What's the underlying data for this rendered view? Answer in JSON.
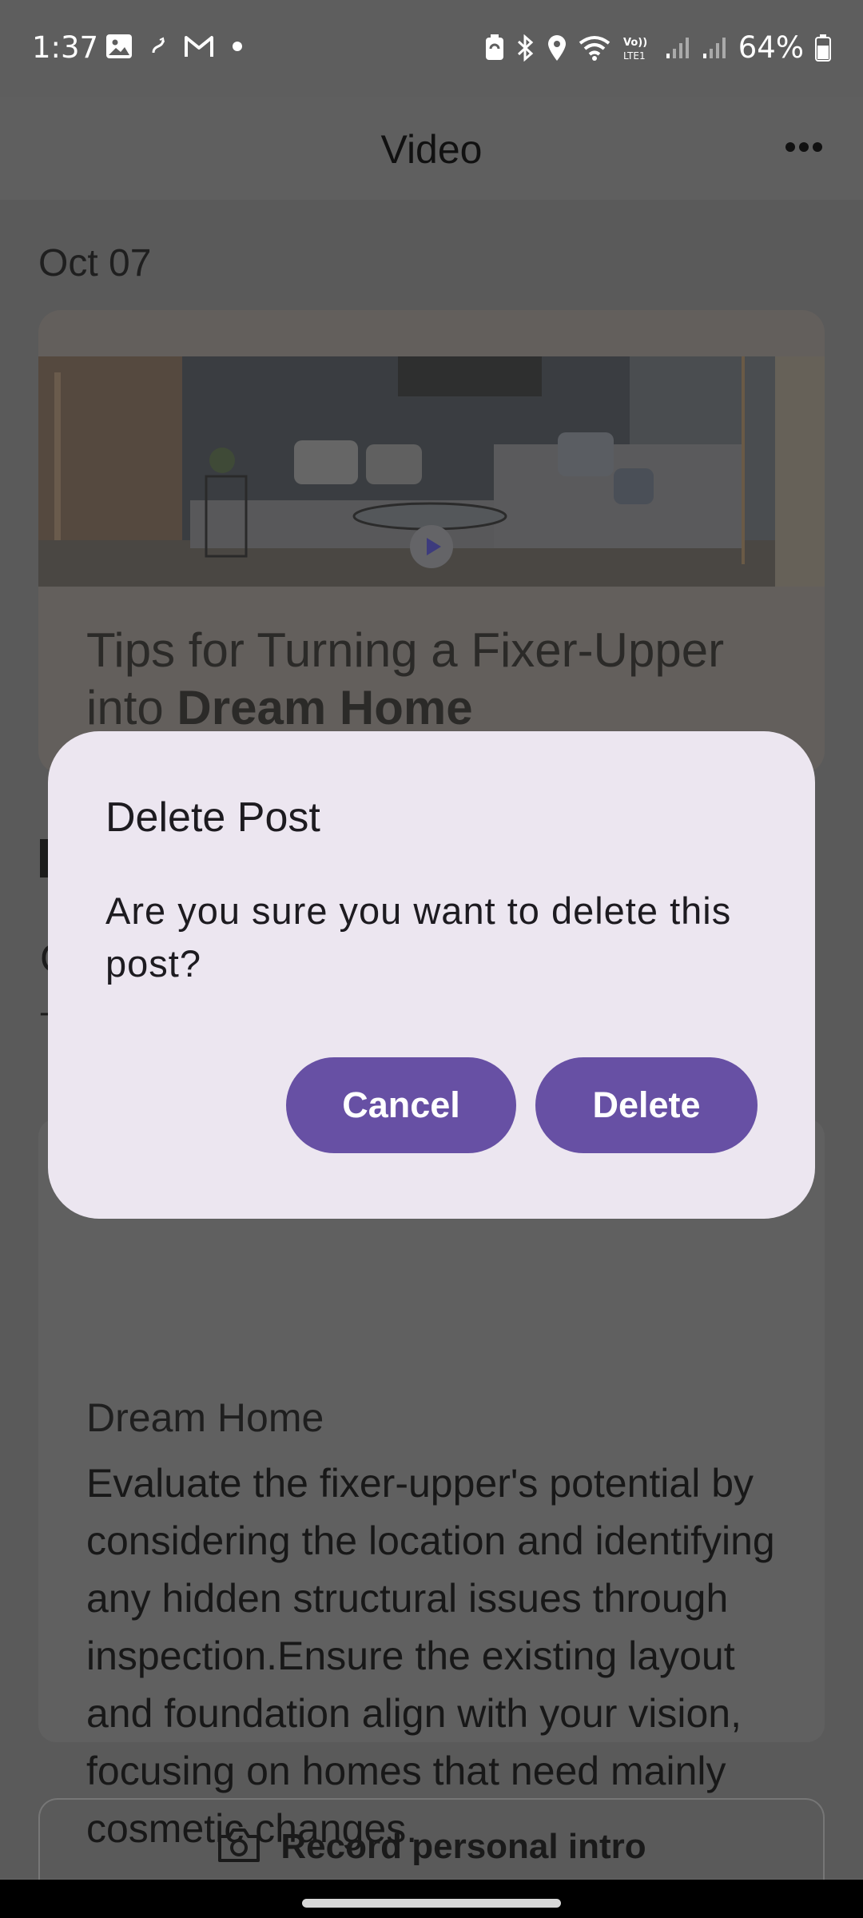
{
  "status_bar": {
    "time": "1:37",
    "battery": "64%",
    "left_icons": [
      "image-icon",
      "sync-icon",
      "gmail-icon",
      "dot-icon"
    ],
    "right_icons": [
      "battery-saver-icon",
      "bluetooth-icon",
      "location-icon",
      "wifi-icon",
      "volte-icon",
      "signal-icon",
      "signal-icon",
      "battery-icon"
    ],
    "volte_label": "Vo)) LTE1"
  },
  "app_bar": {
    "title": "Video",
    "more_icon": "more-horizontal-icon"
  },
  "content": {
    "date": "Oct 07",
    "post": {
      "title_regular": "Tips for Turning a Fixer-Upper into ",
      "title_bold": "Dream Home",
      "play_icon": "play-icon"
    },
    "detail": {
      "heading": "Dream Home",
      "body": "Evaluate the fixer-upper's potential by considering the location and identifying any hidden structural issues through inspection.Ensure the existing layout and foundation align with your vision, focusing on homes that need mainly cosmetic changes."
    },
    "left_peek_1": "C",
    "left_peek_2": "T",
    "record_button": {
      "label": "Record personal intro",
      "icon": "camera-icon"
    }
  },
  "dialog": {
    "title": "Delete Post",
    "message": "Are you sure you want to delete this post?",
    "cancel_label": "Cancel",
    "delete_label": "Delete",
    "accent_color": "#6750a4",
    "surface_color": "#ece6f0"
  }
}
